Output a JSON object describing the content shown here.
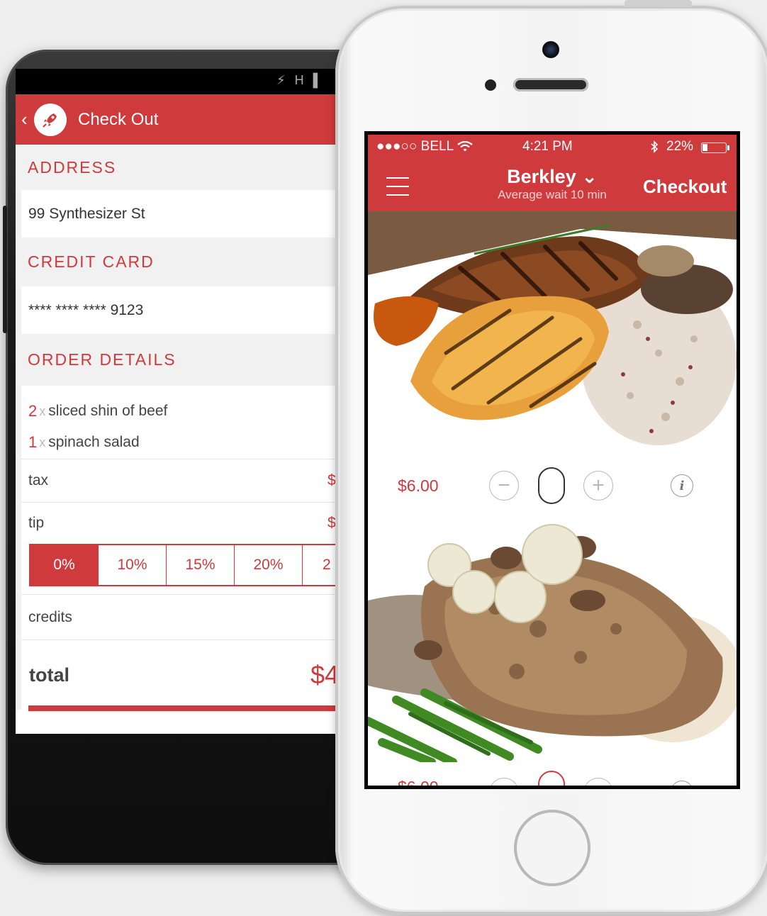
{
  "android": {
    "status_icons": "⚡ H ▌",
    "back_glyph": "‹",
    "logo_glyph": "🚀",
    "title": "Check Out",
    "address": {
      "heading": "ADDRESS",
      "value": "99 Synthesizer St"
    },
    "credit_card": {
      "heading": "CREDIT CARD",
      "value": "**** **** **** 9123"
    },
    "order": {
      "heading": "ORDER DETAILS",
      "items": [
        {
          "qty": "2",
          "x": "x",
          "name": "sliced shin of beef"
        },
        {
          "qty": "1",
          "x": "x",
          "name": "spinach salad"
        }
      ],
      "tax_label": "tax",
      "tax_value": "$",
      "tip_label": "tip",
      "tip_value": "$",
      "tip_options": [
        "0%",
        "10%",
        "15%",
        "20%",
        "2"
      ],
      "tip_selected_index": 0,
      "credits_label": "credits",
      "total_label": "total",
      "total_value": "$4"
    }
  },
  "iphone": {
    "status": {
      "carrier": "●●●○○ BELL",
      "time": "4:21 PM",
      "battery": "22%",
      "battery_level": 0.22
    },
    "location": {
      "name": "Berkley ⌄",
      "subtitle": "Average wait 10 min"
    },
    "checkout_label": "Checkout",
    "items": [
      {
        "price": "$6.00",
        "minus": "−",
        "plus": "+",
        "info": "i"
      },
      {
        "price": "$6.00",
        "minus": "−",
        "plus": "+",
        "info": "i"
      }
    ]
  },
  "colors": {
    "accent": "#cf3a3c"
  }
}
